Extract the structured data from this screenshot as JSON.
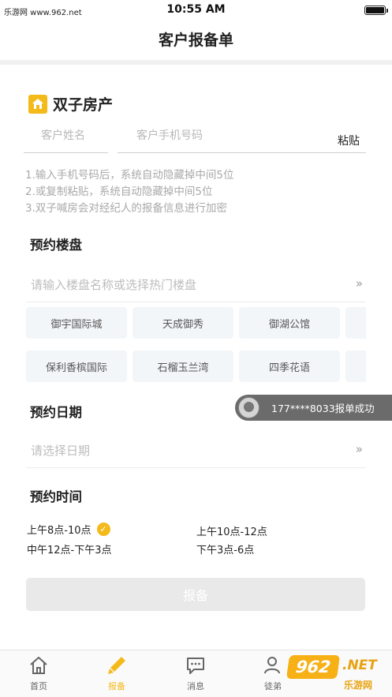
{
  "status_bar": {
    "watermark_text": "乐游网 www.962.net",
    "time": "10:55 AM"
  },
  "header": {
    "title": "客户报备单"
  },
  "brand": {
    "name": "双子房产",
    "icon": "house-logo-icon",
    "color": "#f4ba1a"
  },
  "form": {
    "name_placeholder": "客户姓名",
    "phone_placeholder": "客户手机号码",
    "paste_label": "粘贴",
    "tips": [
      "1.输入手机号码后，系统自动隐藏掉中间5位",
      "2.或复制粘贴，系统自动隐藏掉中间5位",
      "3.双子喊房会对经纪人的报备信息进行加密"
    ]
  },
  "property": {
    "section_title": "预约楼盘",
    "placeholder": "请输入楼盘名称或选择热门楼盘",
    "chevron": "»",
    "hot_row1": [
      "御宇国际城",
      "天成御秀",
      "御湖公馆",
      ""
    ],
    "hot_row2": [
      "保利香槟国际",
      "石榴玉兰湾",
      "四季花语",
      ""
    ]
  },
  "toast": {
    "text": "177****8033报单成功"
  },
  "date": {
    "section_title": "预约日期",
    "placeholder": "请选择日期",
    "chevron": "»"
  },
  "time": {
    "section_title": "预约时间",
    "options": [
      "上午8点-10点",
      "上午10点-12点",
      "中午12点-下午3点",
      "下午3点-6点"
    ],
    "selected_index": 0,
    "check": "✓"
  },
  "submit": {
    "label": "报备",
    "disabled": true
  },
  "tabbar": {
    "active_color": "#f4ba1a",
    "items": [
      {
        "label": "首页",
        "icon": "home-icon"
      },
      {
        "label": "报备",
        "icon": "pencil-icon"
      },
      {
        "label": "消息",
        "icon": "message-icon"
      },
      {
        "label": "徒弟",
        "icon": "users-icon"
      }
    ]
  },
  "watermark": {
    "badge": "962",
    "net": ".NET",
    "cn": "乐游网"
  }
}
